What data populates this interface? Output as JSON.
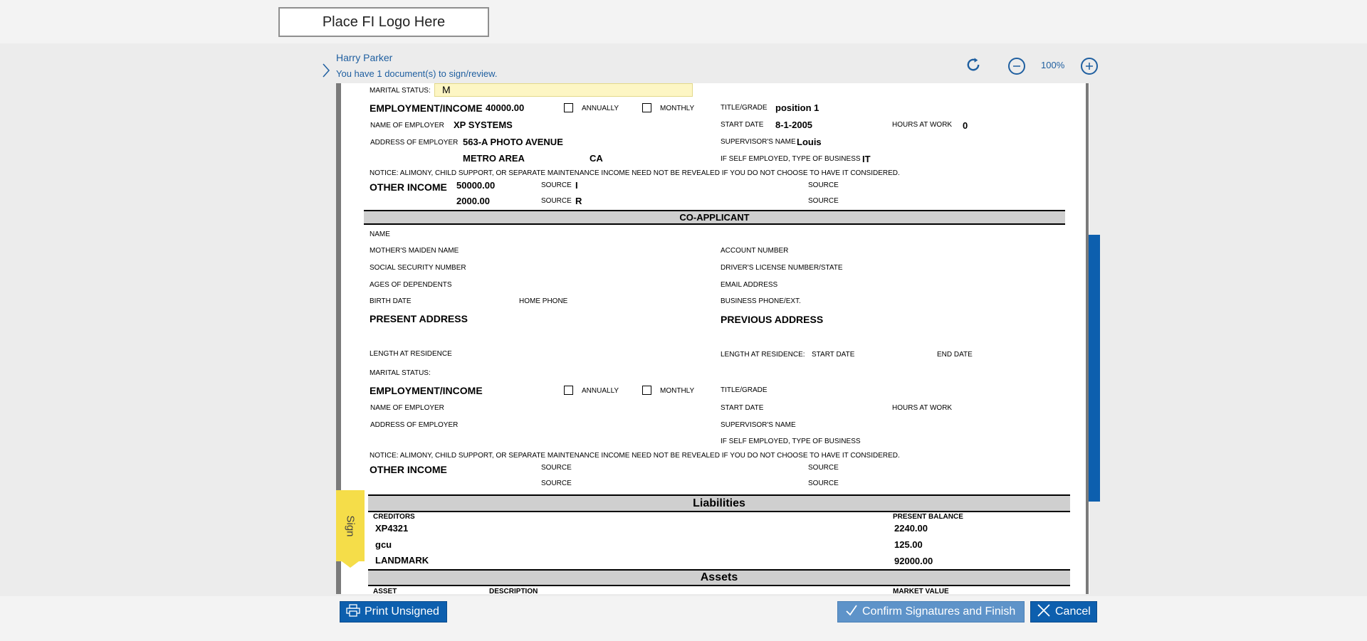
{
  "logo": {
    "text": "Place FI Logo Here"
  },
  "header": {
    "user_name": "Harry Parker",
    "doc_message": "You have 1 document(s) to sign/review.",
    "zoom": "100%"
  },
  "sign_tab": {
    "label": "Sign"
  },
  "form": {
    "marital_status_label": "MARITAL STATUS:",
    "marital_status_value": "M",
    "employment_income_label": "EMPLOYMENT/INCOME",
    "employment_income_value": "40000.00",
    "annually": "ANNUALLY",
    "monthly": "MONTHLY",
    "title_grade_label": "TITLE/GRADE",
    "title_grade_value": "position 1",
    "name_employer_label": "NAME OF EMPLOYER",
    "name_employer_value": "XP SYSTEMS",
    "start_date_label": "START DATE",
    "start_date_value": "8-1-2005",
    "hours_at_work_label": "HOURS AT WORK",
    "hours_at_work_value": "0",
    "address_employer_label": "ADDRESS OF EMPLOYER",
    "address_employer_value": "563-A PHOTO AVENUE",
    "supervisor_label": "SUPERVISOR'S NAME",
    "supervisor_value": "Louis",
    "city_value": "METRO AREA",
    "state_value": "CA",
    "self_employed_label": "IF SELF EMPLOYED, TYPE OF BUSINESS",
    "self_employed_value": "IT",
    "notice": "NOTICE: ALIMONY, CHILD SUPPORT, OR SEPARATE MAINTENANCE INCOME NEED NOT BE REVEALED IF YOU DO NOT CHOOSE TO HAVE IT CONSIDERED.",
    "other_income_label": "OTHER INCOME",
    "other_income_1": "50000.00",
    "other_income_2": "2000.00",
    "source_label": "SOURCE",
    "source_1": "I",
    "source_2": "R",
    "co_applicant_header": "CO-APPLICANT",
    "name_label": "NAME",
    "maiden_label": "MOTHER'S MAIDEN NAME",
    "account_label": "ACCOUNT NUMBER",
    "ssn_label": "SOCIAL SECURITY NUMBER",
    "dl_label": "DRIVER'S LICENSE NUMBER/STATE",
    "ages_label": "AGES OF DEPENDENTS",
    "email_label": "EMAIL ADDRESS",
    "birth_label": "BIRTH DATE",
    "home_phone_label": "HOME PHONE",
    "business_phone_label": "BUSINESS PHONE/EXT.",
    "present_address_label": "PRESENT ADDRESS",
    "previous_address_label": "PREVIOUS ADDRESS",
    "length_residence_label": "LENGTH AT RESIDENCE",
    "length_residence2_label": "LENGTH AT RESIDENCE:",
    "prev_start_date_label": "START DATE",
    "end_date_label": "END DATE",
    "liabilities_header": "Liabilities",
    "creditors_label": "CREDITORS",
    "present_balance_label": "PRESENT BALANCE",
    "creditors": [
      {
        "name": "XP4321",
        "balance": "2240.00"
      },
      {
        "name": "gcu",
        "balance": "125.00"
      },
      {
        "name": "LANDMARK",
        "balance": "92000.00"
      }
    ],
    "assets_header": "Assets",
    "asset_label": "ASSET",
    "description_label": "DESCRIPTION",
    "market_value_label": "MARKET VALUE"
  },
  "footer": {
    "print_label": "Print Unsigned",
    "confirm_label": "Confirm Signatures and Finish",
    "cancel_label": "Cancel"
  },
  "colors": {
    "accent": "#0d5fae",
    "confirm": "#5e93c9",
    "sign_tab": "#f5dd49"
  }
}
